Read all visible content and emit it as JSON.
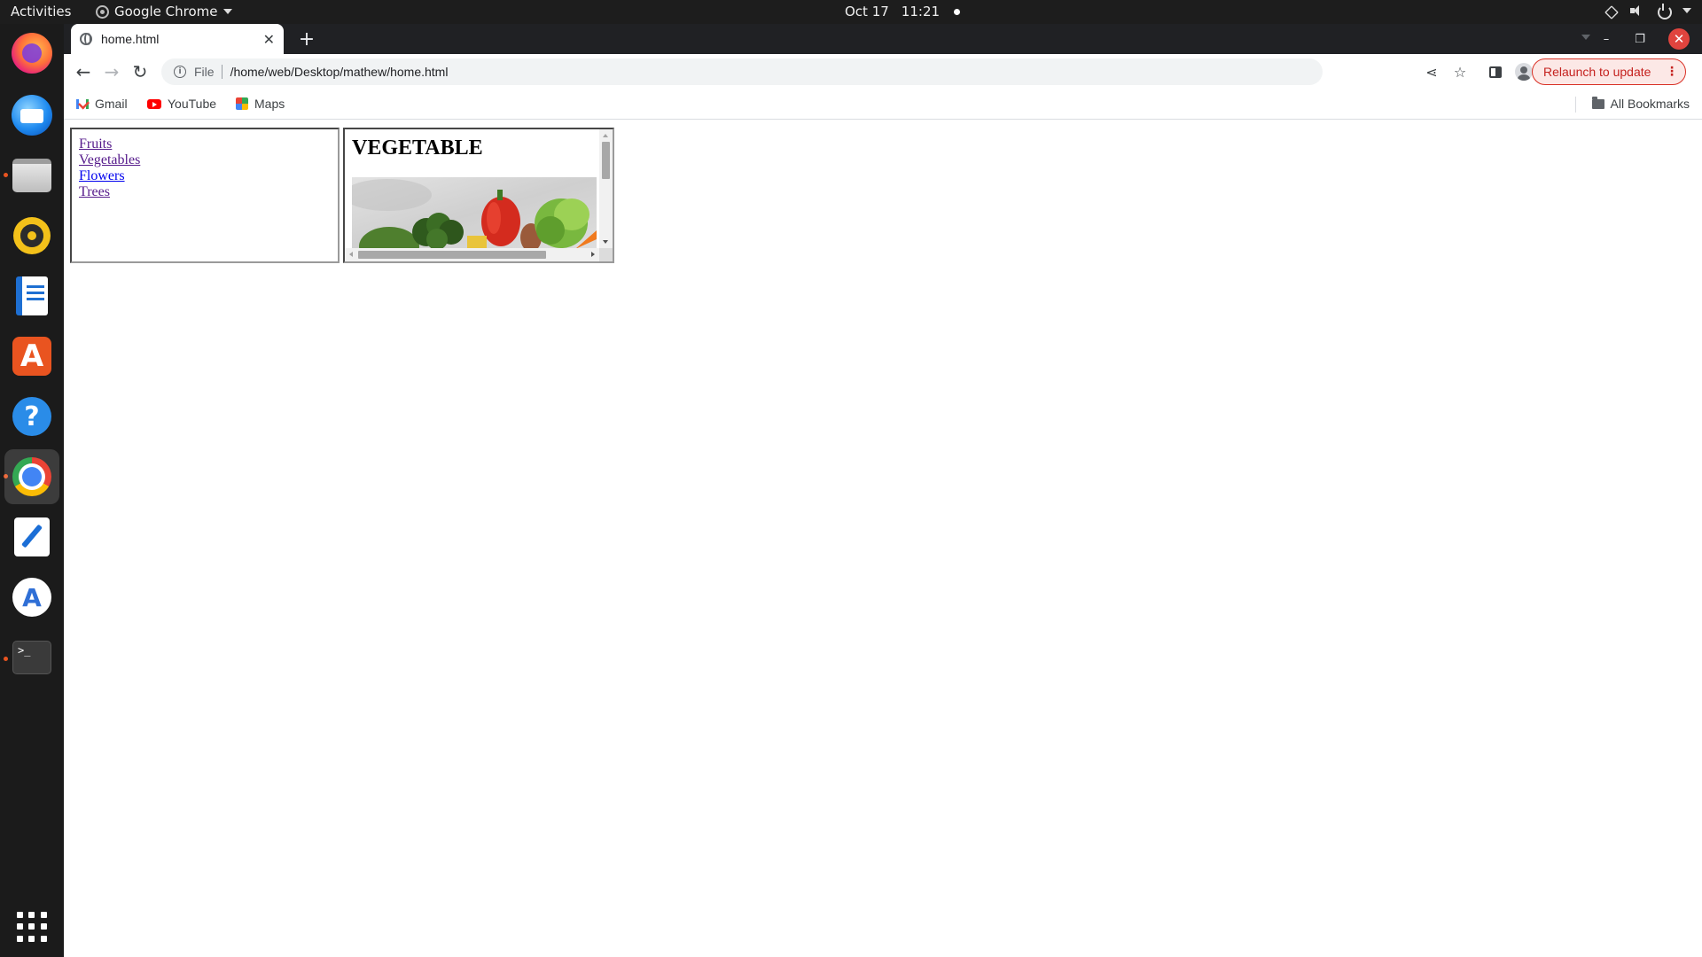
{
  "topbar": {
    "activities": "Activities",
    "app_name": "Google Chrome",
    "date": "Oct 17",
    "time": "11:21"
  },
  "dock": {
    "items": [
      "firefox-icon",
      "thunderbird-icon",
      "files-icon",
      "rhythmbox-icon",
      "libreoffice-writer-icon",
      "app-center-icon",
      "help-icon",
      "chrome-icon",
      "text-editor-icon",
      "android-studio-icon",
      "terminal-icon",
      "show-apps-icon"
    ],
    "terminal_prompt": ">_"
  },
  "browser": {
    "tab_title": "home.html",
    "new_tab": "+",
    "address_scheme": "File",
    "address_url": "/home/web/Desktop/mathew/home.html",
    "relaunch_label": "Relaunch to update",
    "bookmarks": [
      "Gmail",
      "YouTube",
      "Maps"
    ],
    "all_bookmarks": "All Bookmarks"
  },
  "page": {
    "nav_links": [
      "Fruits",
      "Vegetables",
      "Flowers",
      "Trees"
    ],
    "content_title": "VEGETABLE"
  },
  "colors": {
    "visited_link": "#551a8b",
    "relaunch_accent": "#d93025",
    "ubuntu_orange": "#e95420"
  }
}
